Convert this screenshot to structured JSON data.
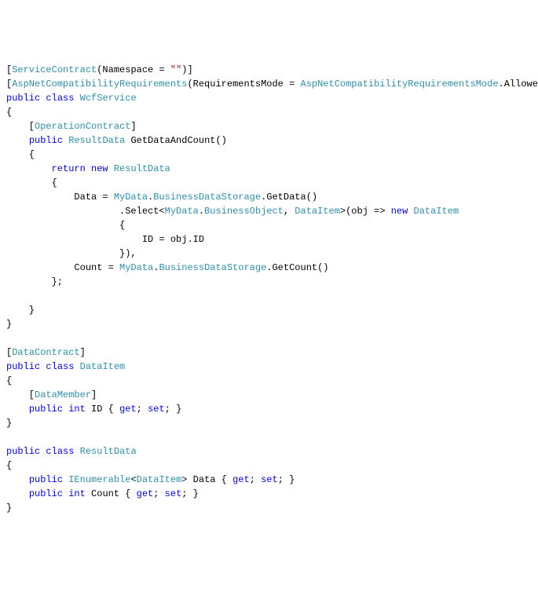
{
  "code": {
    "line1_p1": "[",
    "line1_p2": "ServiceContract",
    "line1_p3": "(Namespace = ",
    "line1_p4": "\"\"",
    "line1_p5": ")]",
    "line2_p1": "[",
    "line2_p2": "AspNetCompatibilityRequirements",
    "line2_p3": "(RequirementsMode = ",
    "line2_p4": "AspNetCompatibilityRequirementsMode",
    "line2_p5": ".Allowed)]",
    "line3_p1": "public",
    "line3_p2": " ",
    "line3_p3": "class",
    "line3_p4": " ",
    "line3_p5": "WcfService",
    "line4": "{",
    "line5_p1": "    [",
    "line5_p2": "OperationContract",
    "line5_p3": "]",
    "line6_p1": "    ",
    "line6_p2": "public",
    "line6_p3": " ",
    "line6_p4": "ResultData",
    "line6_p5": " GetDataAndCount()",
    "line7": "    {",
    "line8_p1": "        ",
    "line8_p2": "return",
    "line8_p3": " ",
    "line8_p4": "new",
    "line8_p5": " ",
    "line8_p6": "ResultData",
    "line9": "        {",
    "line10_p1": "            Data = ",
    "line10_p2": "MyData",
    "line10_p3": ".",
    "line10_p4": "BusinessDataStorage",
    "line10_p5": ".GetData()",
    "line11_p1": "                    .Select<",
    "line11_p2": "MyData",
    "line11_p3": ".",
    "line11_p4": "BusinessObject",
    "line11_p5": ", ",
    "line11_p6": "DataItem",
    "line11_p7": ">(obj => ",
    "line11_p8": "new",
    "line11_p9": " ",
    "line11_p10": "DataItem",
    "line12": "                    {",
    "line13": "                        ID = obj.ID",
    "line14": "                    }),",
    "line15_p1": "            Count = ",
    "line15_p2": "MyData",
    "line15_p3": ".",
    "line15_p4": "BusinessDataStorage",
    "line15_p5": ".GetCount()",
    "line16": "        };",
    "line17": "",
    "line18": "    }",
    "line19": "}",
    "line20": "",
    "line21_p1": "[",
    "line21_p2": "DataContract",
    "line21_p3": "]",
    "line22_p1": "public",
    "line22_p2": " ",
    "line22_p3": "class",
    "line22_p4": " ",
    "line22_p5": "DataItem",
    "line23": "{",
    "line24_p1": "    [",
    "line24_p2": "DataMember",
    "line24_p3": "]",
    "line25_p1": "    ",
    "line25_p2": "public",
    "line25_p3": " ",
    "line25_p4": "int",
    "line25_p5": " ID { ",
    "line25_p6": "get",
    "line25_p7": "; ",
    "line25_p8": "set",
    "line25_p9": "; }",
    "line26": "}",
    "line27": "",
    "line28_p1": "public",
    "line28_p2": " ",
    "line28_p3": "class",
    "line28_p4": " ",
    "line28_p5": "ResultData",
    "line29": "{",
    "line30_p1": "    ",
    "line30_p2": "public",
    "line30_p3": " ",
    "line30_p4": "IEnumerable",
    "line30_p5": "<",
    "line30_p6": "DataItem",
    "line30_p7": "> Data { ",
    "line30_p8": "get",
    "line30_p9": "; ",
    "line30_p10": "set",
    "line30_p11": "; }",
    "line31_p1": "    ",
    "line31_p2": "public",
    "line31_p3": " ",
    "line31_p4": "int",
    "line31_p5": " Count { ",
    "line31_p6": "get",
    "line31_p7": "; ",
    "line31_p8": "set",
    "line31_p9": "; }",
    "line32": "}"
  }
}
